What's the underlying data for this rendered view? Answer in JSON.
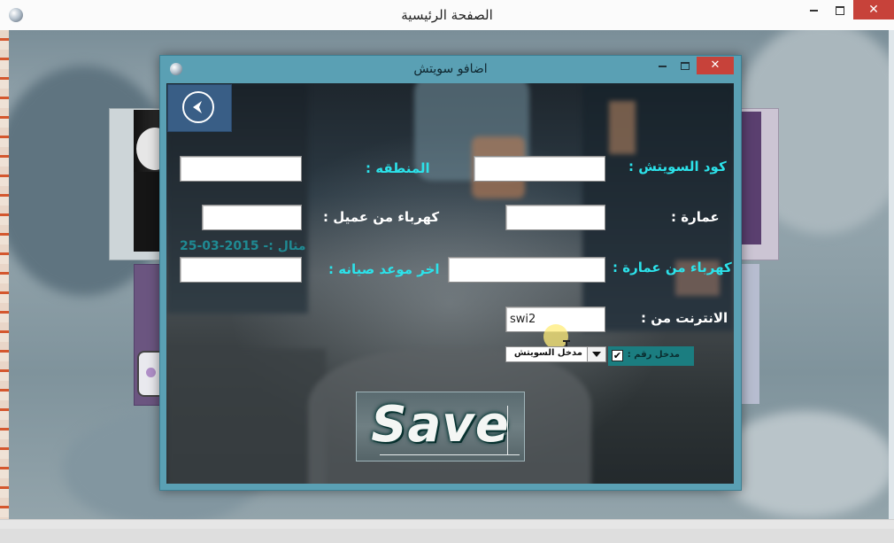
{
  "main_window": {
    "title": "الصفحة الرئيسية",
    "close_glyph": "✕"
  },
  "dialog": {
    "title": "اضافو سويتش",
    "close_glyph": "✕",
    "back_icon": "back-arrow-icon",
    "fields": {
      "switch_code": {
        "label": "كود السويتش :",
        "value": ""
      },
      "region": {
        "label": "المنطقه :",
        "value": ""
      },
      "building": {
        "label": "عمارة :",
        "value": ""
      },
      "client_power": {
        "label": "كهرباء من عميل :",
        "value": ""
      },
      "building_power": {
        "label": "كهرباء من عمارة :",
        "value": ""
      },
      "last_maintenance": {
        "label": "اخر موعد صيانه :",
        "value": ""
      },
      "internet_from": {
        "label": "الانترنت من :",
        "value": "swi2"
      }
    },
    "date_example": "مثال :-  2015-03-25",
    "switch_combo": {
      "selected": "مدخل السويتش"
    },
    "number_checkbox": {
      "label": "مدخل رقم :",
      "checked": true,
      "check_glyph": "✔"
    },
    "save_label": "Save"
  },
  "colors": {
    "dialog_frame": "#5aa0b4",
    "label_cyan": "#2ce2ea",
    "label_white": "#ffffff",
    "back_button": "#395e86",
    "close_button": "#c7423a",
    "checkbox_panel": "#1b7d80"
  }
}
